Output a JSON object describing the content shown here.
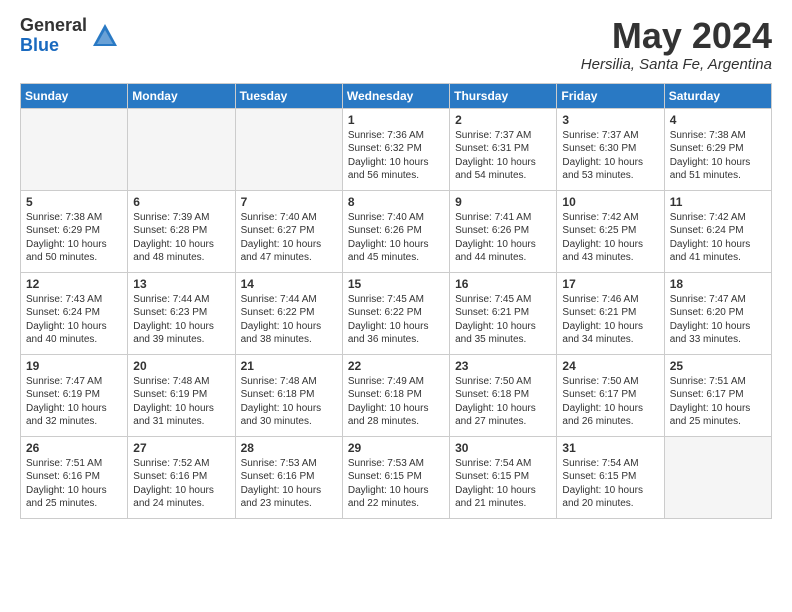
{
  "logo": {
    "general": "General",
    "blue": "Blue"
  },
  "title": "May 2024",
  "location": "Hersilia, Santa Fe, Argentina",
  "weekdays": [
    "Sunday",
    "Monday",
    "Tuesday",
    "Wednesday",
    "Thursday",
    "Friday",
    "Saturday"
  ],
  "weeks": [
    [
      {
        "day": "",
        "info": ""
      },
      {
        "day": "",
        "info": ""
      },
      {
        "day": "",
        "info": ""
      },
      {
        "day": "1",
        "info": "Sunrise: 7:36 AM\nSunset: 6:32 PM\nDaylight: 10 hours and 56 minutes."
      },
      {
        "day": "2",
        "info": "Sunrise: 7:37 AM\nSunset: 6:31 PM\nDaylight: 10 hours and 54 minutes."
      },
      {
        "day": "3",
        "info": "Sunrise: 7:37 AM\nSunset: 6:30 PM\nDaylight: 10 hours and 53 minutes."
      },
      {
        "day": "4",
        "info": "Sunrise: 7:38 AM\nSunset: 6:29 PM\nDaylight: 10 hours and 51 minutes."
      }
    ],
    [
      {
        "day": "5",
        "info": "Sunrise: 7:38 AM\nSunset: 6:29 PM\nDaylight: 10 hours and 50 minutes."
      },
      {
        "day": "6",
        "info": "Sunrise: 7:39 AM\nSunset: 6:28 PM\nDaylight: 10 hours and 48 minutes."
      },
      {
        "day": "7",
        "info": "Sunrise: 7:40 AM\nSunset: 6:27 PM\nDaylight: 10 hours and 47 minutes."
      },
      {
        "day": "8",
        "info": "Sunrise: 7:40 AM\nSunset: 6:26 PM\nDaylight: 10 hours and 45 minutes."
      },
      {
        "day": "9",
        "info": "Sunrise: 7:41 AM\nSunset: 6:26 PM\nDaylight: 10 hours and 44 minutes."
      },
      {
        "day": "10",
        "info": "Sunrise: 7:42 AM\nSunset: 6:25 PM\nDaylight: 10 hours and 43 minutes."
      },
      {
        "day": "11",
        "info": "Sunrise: 7:42 AM\nSunset: 6:24 PM\nDaylight: 10 hours and 41 minutes."
      }
    ],
    [
      {
        "day": "12",
        "info": "Sunrise: 7:43 AM\nSunset: 6:24 PM\nDaylight: 10 hours and 40 minutes."
      },
      {
        "day": "13",
        "info": "Sunrise: 7:44 AM\nSunset: 6:23 PM\nDaylight: 10 hours and 39 minutes."
      },
      {
        "day": "14",
        "info": "Sunrise: 7:44 AM\nSunset: 6:22 PM\nDaylight: 10 hours and 38 minutes."
      },
      {
        "day": "15",
        "info": "Sunrise: 7:45 AM\nSunset: 6:22 PM\nDaylight: 10 hours and 36 minutes."
      },
      {
        "day": "16",
        "info": "Sunrise: 7:45 AM\nSunset: 6:21 PM\nDaylight: 10 hours and 35 minutes."
      },
      {
        "day": "17",
        "info": "Sunrise: 7:46 AM\nSunset: 6:21 PM\nDaylight: 10 hours and 34 minutes."
      },
      {
        "day": "18",
        "info": "Sunrise: 7:47 AM\nSunset: 6:20 PM\nDaylight: 10 hours and 33 minutes."
      }
    ],
    [
      {
        "day": "19",
        "info": "Sunrise: 7:47 AM\nSunset: 6:19 PM\nDaylight: 10 hours and 32 minutes."
      },
      {
        "day": "20",
        "info": "Sunrise: 7:48 AM\nSunset: 6:19 PM\nDaylight: 10 hours and 31 minutes."
      },
      {
        "day": "21",
        "info": "Sunrise: 7:48 AM\nSunset: 6:18 PM\nDaylight: 10 hours and 30 minutes."
      },
      {
        "day": "22",
        "info": "Sunrise: 7:49 AM\nSunset: 6:18 PM\nDaylight: 10 hours and 28 minutes."
      },
      {
        "day": "23",
        "info": "Sunrise: 7:50 AM\nSunset: 6:18 PM\nDaylight: 10 hours and 27 minutes."
      },
      {
        "day": "24",
        "info": "Sunrise: 7:50 AM\nSunset: 6:17 PM\nDaylight: 10 hours and 26 minutes."
      },
      {
        "day": "25",
        "info": "Sunrise: 7:51 AM\nSunset: 6:17 PM\nDaylight: 10 hours and 25 minutes."
      }
    ],
    [
      {
        "day": "26",
        "info": "Sunrise: 7:51 AM\nSunset: 6:16 PM\nDaylight: 10 hours and 25 minutes."
      },
      {
        "day": "27",
        "info": "Sunrise: 7:52 AM\nSunset: 6:16 PM\nDaylight: 10 hours and 24 minutes."
      },
      {
        "day": "28",
        "info": "Sunrise: 7:53 AM\nSunset: 6:16 PM\nDaylight: 10 hours and 23 minutes."
      },
      {
        "day": "29",
        "info": "Sunrise: 7:53 AM\nSunset: 6:15 PM\nDaylight: 10 hours and 22 minutes."
      },
      {
        "day": "30",
        "info": "Sunrise: 7:54 AM\nSunset: 6:15 PM\nDaylight: 10 hours and 21 minutes."
      },
      {
        "day": "31",
        "info": "Sunrise: 7:54 AM\nSunset: 6:15 PM\nDaylight: 10 hours and 20 minutes."
      },
      {
        "day": "",
        "info": ""
      }
    ]
  ]
}
